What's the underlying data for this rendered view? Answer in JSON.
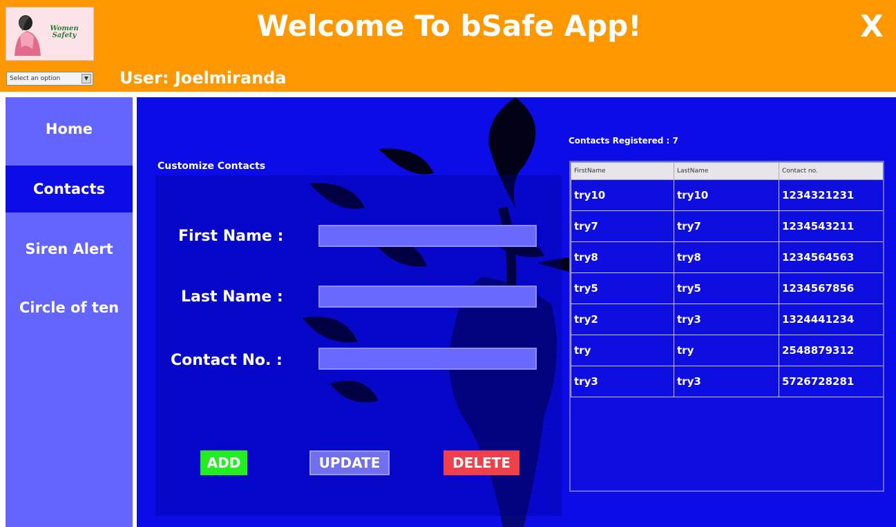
{
  "header": {
    "title": "Welcome To bSafe App!",
    "close_label": "X",
    "logo_text": "Women Safety",
    "select_value": "Select an option",
    "user_prefix": "User:",
    "user_name": "Joelmiranda"
  },
  "sidebar": {
    "items": [
      {
        "label": "Home"
      },
      {
        "label": "Contacts",
        "active": true
      },
      {
        "label": "Siren Alert"
      },
      {
        "label": "Circle of ten"
      }
    ]
  },
  "form": {
    "section_title": "Customize Contacts",
    "first_name_label": "First Name :",
    "last_name_label": "Last Name :",
    "contact_label": "Contact No. :",
    "first_name_value": "",
    "last_name_value": "",
    "contact_value": "",
    "add_label": "ADD",
    "update_label": "UPDATE",
    "delete_label": "DELETE"
  },
  "contacts": {
    "count_label": "Contacts Registered :",
    "count": "7",
    "columns": [
      "FirstName",
      "LastName",
      "Contact no."
    ],
    "rows": [
      [
        "try10",
        "try10",
        "1234321231"
      ],
      [
        "try7",
        "try7",
        "1234543211"
      ],
      [
        "try8",
        "try8",
        "1234564563"
      ],
      [
        "try5",
        "try5",
        "1234567856"
      ],
      [
        "try2",
        "try3",
        "1324441234"
      ],
      [
        "try",
        "try",
        "2548879312"
      ],
      [
        "try3",
        "try3",
        "5726728281"
      ]
    ]
  },
  "colors": {
    "header": "#ff9800",
    "sidebar": "#6464ff",
    "main": "#0c0ce6",
    "add": "#22ee22",
    "update": "#7070ee",
    "delete": "#ee3f4b"
  }
}
